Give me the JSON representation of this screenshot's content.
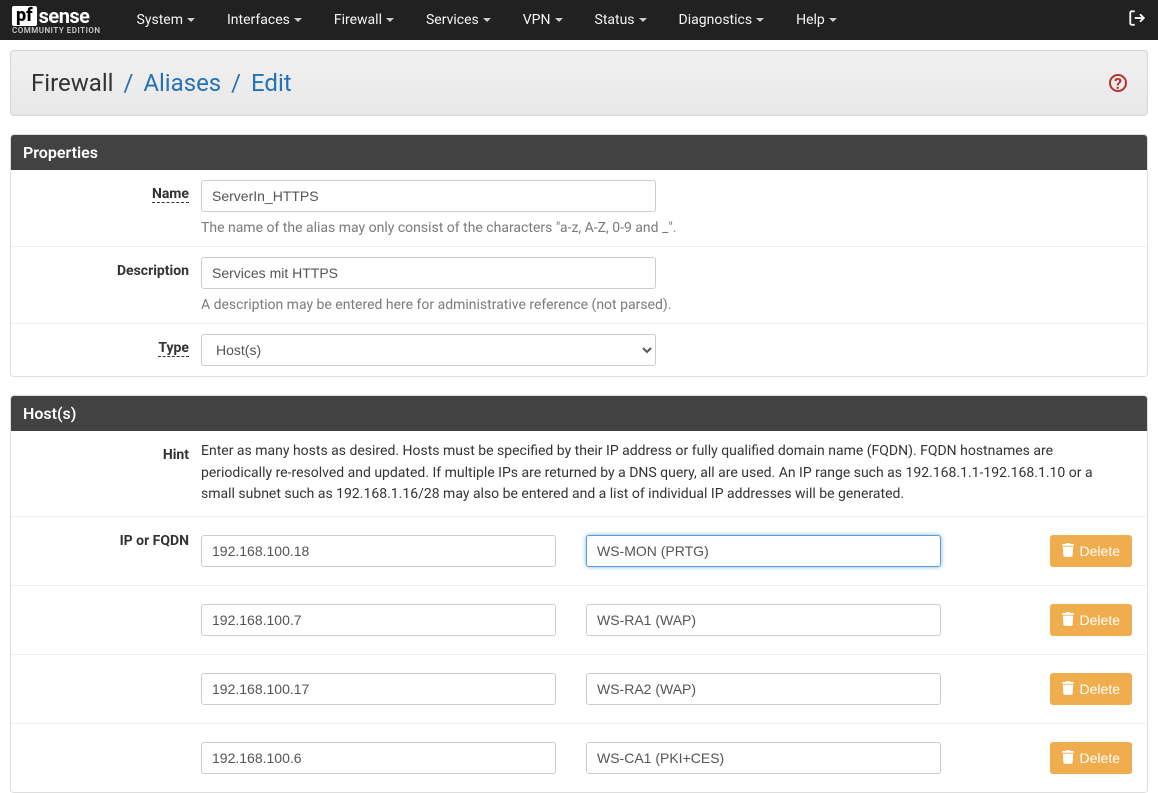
{
  "brand": {
    "pf": "pf",
    "sense": "sense",
    "sub": "COMMUNITY EDITION"
  },
  "nav": [
    "System",
    "Interfaces",
    "Firewall",
    "Services",
    "VPN",
    "Status",
    "Diagnostics",
    "Help"
  ],
  "breadcrumb": {
    "root": "Firewall",
    "mid": "Aliases",
    "leaf": "Edit"
  },
  "panel_properties": {
    "title": "Properties",
    "name": {
      "label": "Name",
      "value": "ServerIn_HTTPS",
      "help": "The name of the alias may only consist of the characters \"a-z, A-Z, 0-9 and _\"."
    },
    "description": {
      "label": "Description",
      "value": "Services mit HTTPS",
      "help": "A description may be entered here for administrative reference (not parsed)."
    },
    "type": {
      "label": "Type",
      "value": "Host(s)"
    }
  },
  "panel_hosts": {
    "title": "Host(s)",
    "hint_label": "Hint",
    "hint_text": "Enter as many hosts as desired. Hosts must be specified by their IP address or fully qualified domain name (FQDN). FQDN hostnames are periodically re-resolved and updated. If multiple IPs are returned by a DNS query, all are used. An IP range such as 192.168.1.1-192.168.1.10 or a small subnet such as 192.168.1.16/28 may also be entered and a list of individual IP addresses will be generated.",
    "ip_label": "IP or FQDN",
    "delete_label": "Delete",
    "rows": [
      {
        "ip": "192.168.100.18",
        "desc": "WS-MON (PRTG)",
        "focused": true
      },
      {
        "ip": "192.168.100.7",
        "desc": "WS-RA1 (WAP)"
      },
      {
        "ip": "192.168.100.17",
        "desc": "WS-RA2 (WAP)"
      },
      {
        "ip": "192.168.100.6",
        "desc": "WS-CA1 (PKI+CES)"
      }
    ]
  }
}
